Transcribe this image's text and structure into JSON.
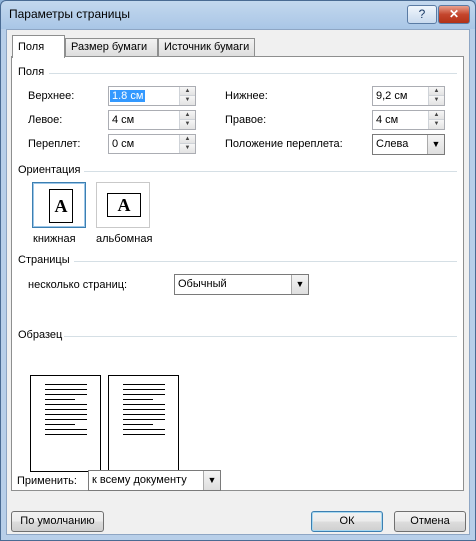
{
  "window": {
    "title": "Параметры страницы",
    "help_glyph": "?",
    "close_glyph": "✕"
  },
  "tabs": [
    {
      "label": "Поля",
      "active": true
    },
    {
      "label": "Размер бумаги"
    },
    {
      "label": "Источник бумаги"
    }
  ],
  "margins": {
    "section_title": "Поля",
    "top": {
      "label": "Верхнее:",
      "value": "1.8 см"
    },
    "left": {
      "label": "Левое:",
      "value": "4 см"
    },
    "gutter": {
      "label": "Переплет:",
      "value": "0 см"
    },
    "bottom": {
      "label": "Нижнее:",
      "value": "9,2 см"
    },
    "right": {
      "label": "Правое:",
      "value": "4 см"
    },
    "gutter_pos": {
      "label": "Положение переплета:",
      "value": "Слева"
    }
  },
  "orientation": {
    "section_title": "Ориентация",
    "portrait": {
      "label": "книжная",
      "glyph": "A",
      "selected": true
    },
    "landscape": {
      "label": "альбомная",
      "glyph": "A"
    }
  },
  "pages": {
    "section_title": "Страницы",
    "multiple": {
      "label": "несколько страниц:",
      "value": "Обычный"
    }
  },
  "sample": {
    "section_title": "Образец"
  },
  "apply": {
    "label": "Применить:",
    "value": "к всему документу"
  },
  "buttons": {
    "default": "По умолчанию",
    "ok": "ОК",
    "cancel": "Отмена"
  }
}
